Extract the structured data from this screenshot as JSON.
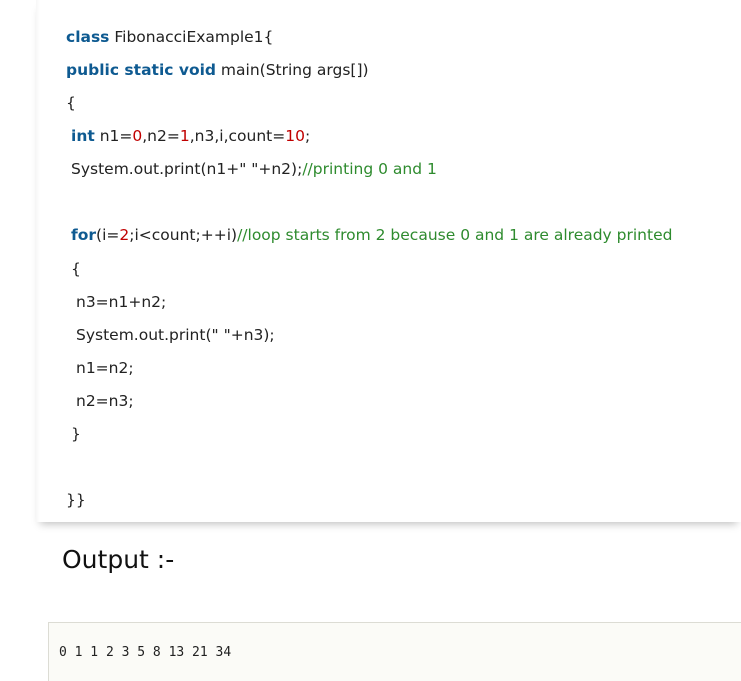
{
  "code": {
    "l1_kw": "class",
    "l1_rest": " FibonacciExample1{",
    "l2_kw": "public static void",
    "l2_rest": " main(String args[])",
    "l3": "{",
    "l4_kw": "int",
    "l4_a": " n1=",
    "l4_n1": "0",
    "l4_b": ",n2=",
    "l4_n2": "1",
    "l4_c": ",n3,i,count=",
    "l4_n3": "10",
    "l4_d": ";",
    "l5_a": "System.out.print(n1+",
    "l5_str": "\" \"",
    "l5_b": "+n2);",
    "l5_cmt": "//printing 0 and 1",
    "l6_kw": "for",
    "l6_a": "(i=",
    "l6_n": "2",
    "l6_b": ";i<count;++i)",
    "l6_cmt": "//loop starts from 2 because 0 and 1 are already printed",
    "l7": "{",
    "l8": "n3=n1+n2;",
    "l9_a": "System.out.print(",
    "l9_str": "\" \"",
    "l9_b": "+n3);",
    "l10": "n1=n2;",
    "l11": "n2=n3;",
    "l12": "}",
    "l13": "}}"
  },
  "output": {
    "heading": "Output :-",
    "result": "0 1 1 2 3 5 8 13 21 34"
  }
}
